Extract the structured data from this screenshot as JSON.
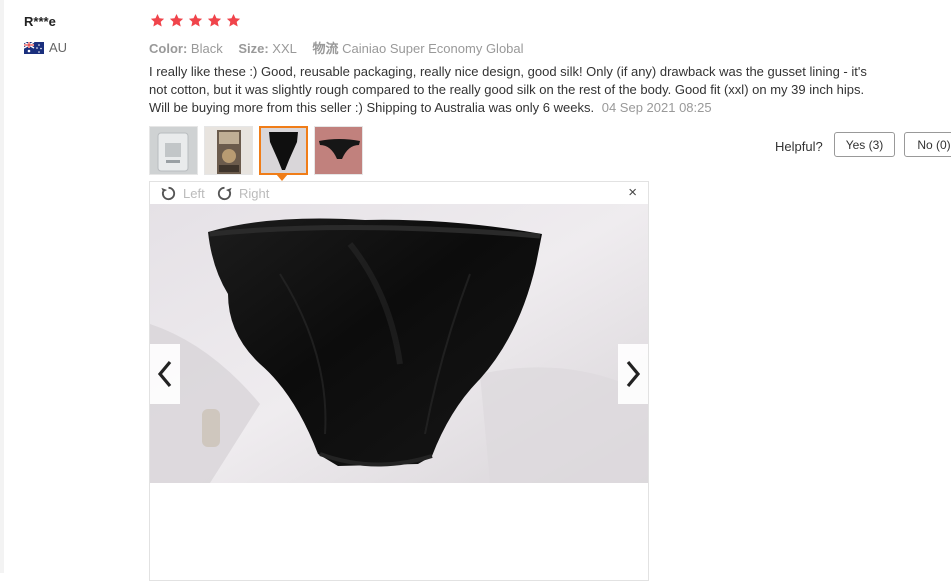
{
  "review": {
    "user": "R***e",
    "country": "AU",
    "rating": 5,
    "meta": {
      "color_key": "Color:",
      "color_value": "Black",
      "size_key": "Size:",
      "size_value": "XXL",
      "ship_key": "物流",
      "ship_value": "Cainiao Super Economy Global"
    },
    "text": "I really like these :) Good, reusable packaging, really nice design, good silk! Only (if any) drawback was the gusset lining - it's not cotton, but it was slightly rough compared to the really good silk on the rest of the body. Good fit (xxl) on my 39 inch hips. Will be buying more from this seller :) Shipping to Australia was only 6 weeks.",
    "date": "04 Sep 2021 08:25"
  },
  "helpful": {
    "label": "Helpful?",
    "yes": "Yes (3)",
    "no": "No (0)"
  },
  "viewer": {
    "left_label": "Left",
    "right_label": "Right",
    "close_symbol": "×"
  },
  "thumbnails": [
    {
      "icon": "packaging-photo",
      "active": false
    },
    {
      "icon": "packaging-open-photo",
      "active": false
    },
    {
      "icon": "black-underwear-photo",
      "active": true
    },
    {
      "icon": "worn-underwear-photo",
      "active": false
    }
  ],
  "colors": {
    "star": "#f0444b",
    "accent_orange": "#f07d18"
  }
}
